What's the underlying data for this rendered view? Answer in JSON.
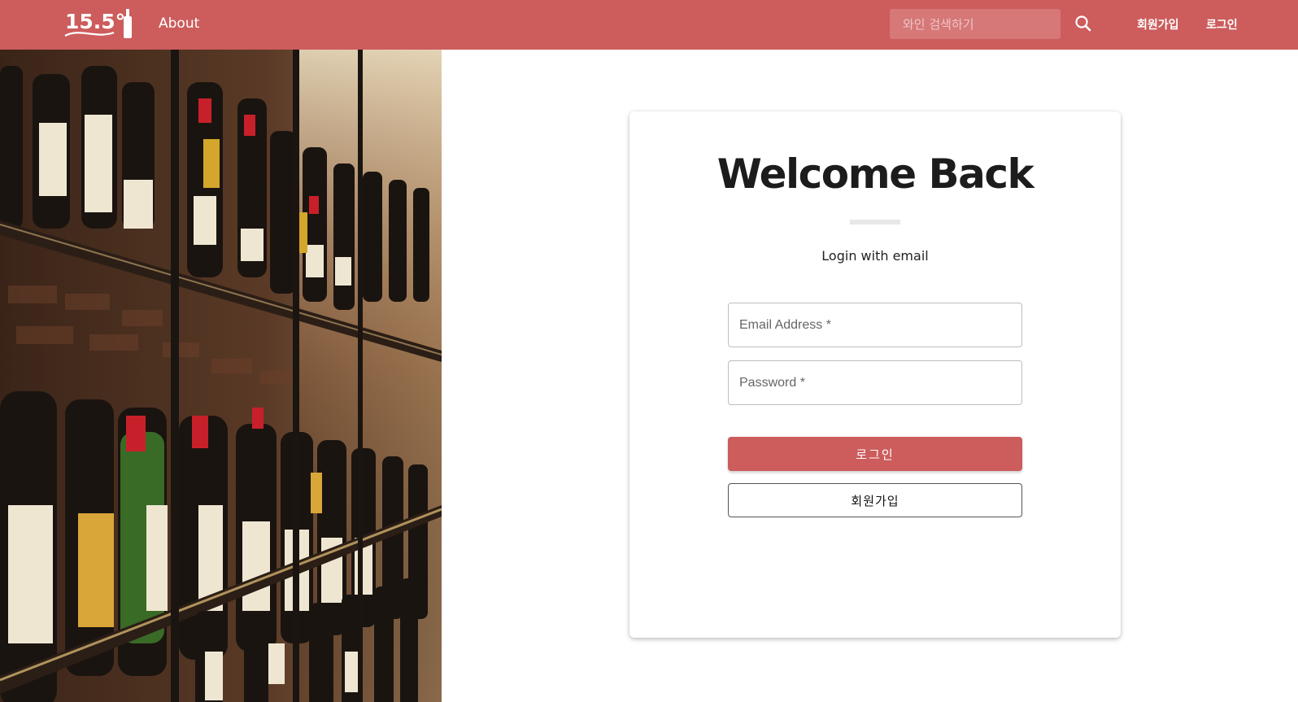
{
  "brand": {
    "logo_text": "15.5°",
    "accent_color": "#cd5c5c"
  },
  "nav": {
    "about": "About",
    "search_placeholder": "와인 검색하기",
    "search_icon": "search-icon",
    "signup": "회원가입",
    "login": "로그인"
  },
  "hero": {
    "image": "wine-bottles-on-shelves"
  },
  "login_card": {
    "title": "Welcome Back",
    "subtitle": "Login with email",
    "email_placeholder": "Email Address *",
    "password_placeholder": "Password *",
    "login_button": "로그인",
    "signup_button": "회원가입"
  }
}
